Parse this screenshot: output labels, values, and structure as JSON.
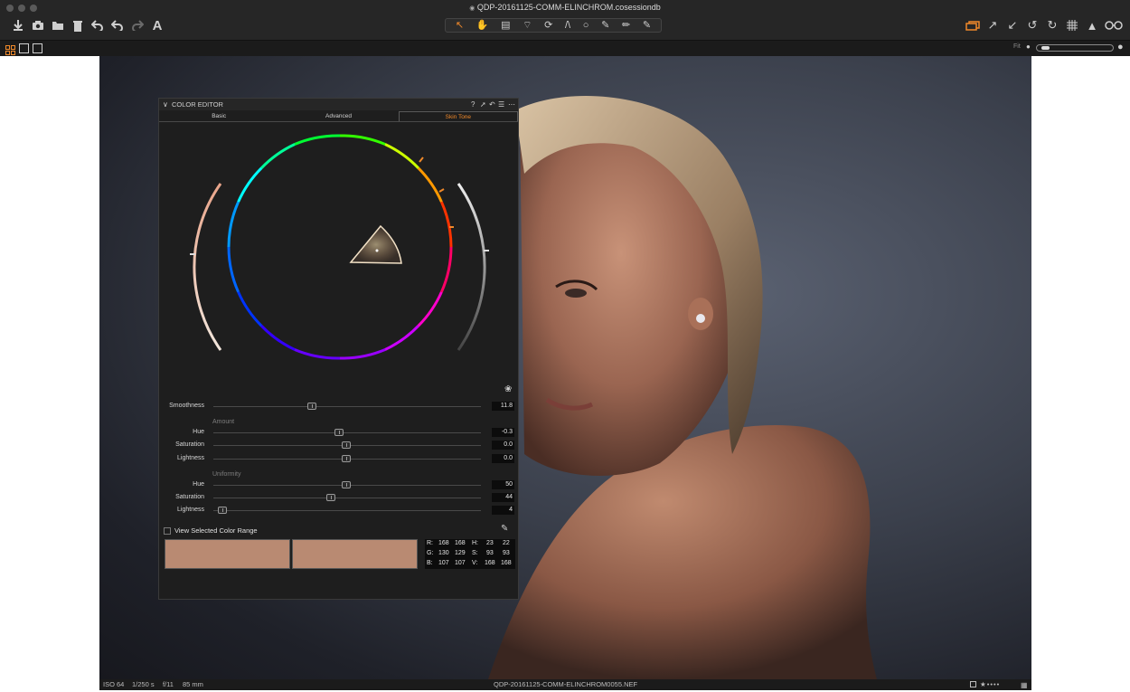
{
  "window": {
    "title": "QDP-20161125-COMM-ELINCHROM.cosessiondb"
  },
  "toolbar": {
    "left_icons": [
      "import-icon",
      "camera-icon",
      "folder-icon",
      "trash-icon",
      "undo-icon",
      "undo-alt-icon",
      "redo-icon",
      "text-icon"
    ],
    "center_tools": [
      "cursor-tool",
      "pan-tool",
      "loupe-tool",
      "crop-tool",
      "rotate-tool",
      "keystone-tool",
      "spot-tool",
      "brush-tool",
      "eraser-tool",
      "picker-tool"
    ],
    "right_icons": [
      "stack-icon",
      "expand-icon",
      "collapse-icon",
      "rotate-left-icon",
      "rotate-right-icon",
      "grid-icon",
      "warning-icon",
      "glasses-icon"
    ]
  },
  "subbar": {
    "fit_label": "Fit"
  },
  "panel": {
    "title": "COLOR EDITOR",
    "header_icons": [
      "help-icon",
      "pin-icon",
      "reset-icon",
      "menu-icon",
      "more-icon"
    ],
    "tabs": [
      {
        "label": "Basic",
        "active": false
      },
      {
        "label": "Advanced",
        "active": false
      },
      {
        "label": "Skin Tone",
        "active": true
      }
    ],
    "smoothness": {
      "label": "Smoothness",
      "value": "11.8",
      "position": 0.37
    },
    "amount": {
      "label": "Amount",
      "sliders": [
        {
          "label": "Hue",
          "value": "-0.3",
          "position": 0.47
        },
        {
          "label": "Saturation",
          "value": "0.0",
          "position": 0.5
        },
        {
          "label": "Lightness",
          "value": "0.0",
          "position": 0.5
        }
      ]
    },
    "uniformity": {
      "label": "Uniformity",
      "sliders": [
        {
          "label": "Hue",
          "value": "50",
          "position": 0.5
        },
        {
          "label": "Saturation",
          "value": "44",
          "position": 0.44
        },
        {
          "label": "Lightness",
          "value": "4",
          "position": 0.04
        }
      ]
    },
    "view_range": {
      "label": "View Selected Color Range",
      "checked": false
    },
    "swatches": {
      "left": "#b98a72",
      "right": "#b98a72"
    },
    "readout": {
      "R_label": "R:",
      "R1": "168",
      "R2": "168",
      "G_label": "G:",
      "G1": "130",
      "G2": "129",
      "B_label": "B:",
      "B1": "107",
      "B2": "107",
      "H_label": "H:",
      "H1": "23",
      "H2": "22",
      "S_label": "S:",
      "S1": "93",
      "S2": "93",
      "V_label": "V:",
      "V1": "168",
      "V2": "168"
    }
  },
  "statusbar": {
    "iso": "ISO 64",
    "shutter": "1/250 s",
    "aperture": "f/11",
    "focal": "85 mm",
    "filename": "QDP-20161125-COMM-ELINCHROM0055.NEF"
  },
  "colors": {
    "accent": "#f0892a",
    "toolbar_bg": "#262626",
    "panel_bg": "#1e1e1e"
  }
}
